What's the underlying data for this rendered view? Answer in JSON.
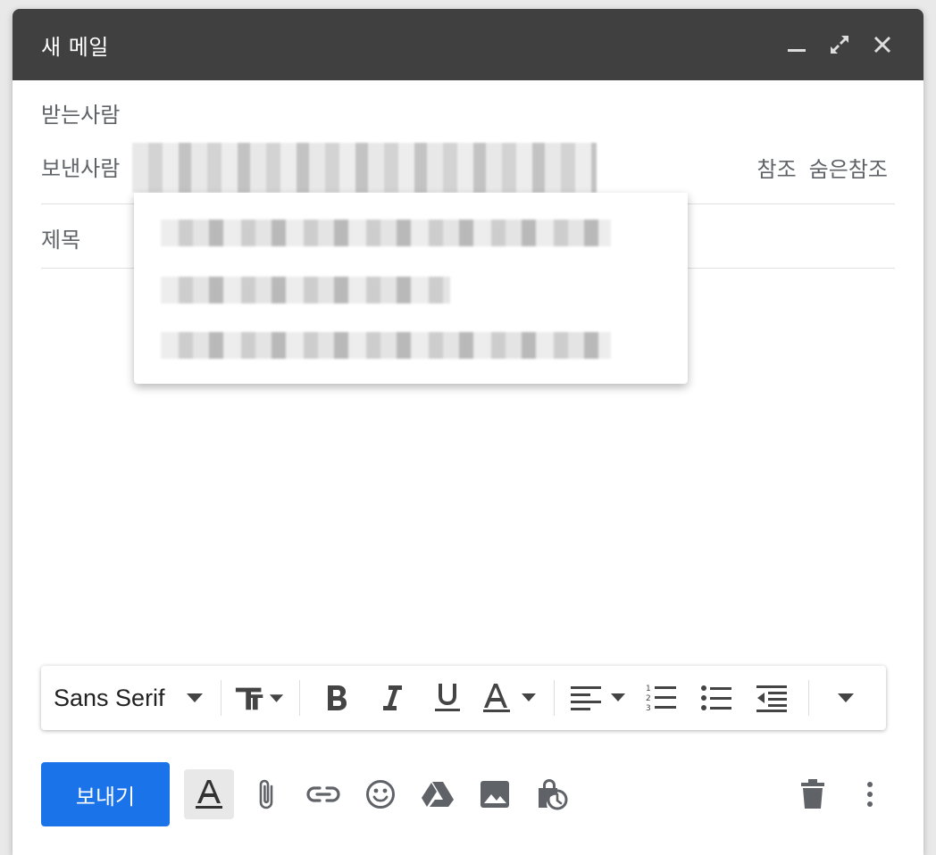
{
  "window": {
    "title": "새 메일"
  },
  "fields": {
    "to_label": "받는사람",
    "from_label": "보낸사람",
    "subject_label": "제목",
    "cc_label": "참조",
    "bcc_label": "숨은참조"
  },
  "toolbar": {
    "font_name": "Sans Serif"
  },
  "actions": {
    "send_label": "보내기"
  },
  "colors": {
    "titlebar": "#404040",
    "send_button": "#1a73e8",
    "icon": "#5f6368"
  },
  "icons": [
    "minimize-icon",
    "expand-icon",
    "close-icon",
    "text-size-icon",
    "bold-icon",
    "italic-icon",
    "underline-icon",
    "text-color-icon",
    "align-icon",
    "numbered-list-icon",
    "bulleted-list-icon",
    "indent-less-icon",
    "more-formatting-icon",
    "formatting-options-icon",
    "attach-icon",
    "link-icon",
    "emoji-icon",
    "drive-icon",
    "photo-icon",
    "confidential-icon",
    "trash-icon",
    "more-options-icon"
  ]
}
